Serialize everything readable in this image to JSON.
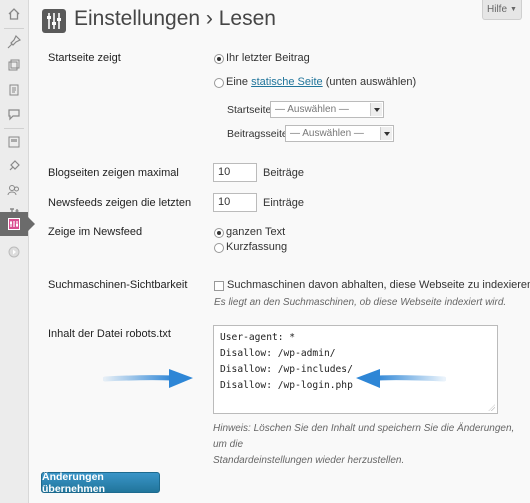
{
  "header": {
    "title": "Einstellungen › Lesen",
    "help_label": "Hilfe"
  },
  "sidebar": {
    "icons": [
      "home-icon",
      "pin-icon",
      "media-icon",
      "pages-icon",
      "comments-icon",
      "appearance-icon",
      "plugins-icon",
      "users-icon",
      "tools-icon",
      "settings-icon",
      "collapse-icon"
    ]
  },
  "front_page": {
    "label": "Startseite zeigt",
    "option_latest": "Ihr letzter Beitrag",
    "option_static_prefix": "Eine",
    "option_static_link": "statische Seite",
    "option_static_suffix": "(unten auswählen)",
    "startseite_label": "Startseite:",
    "startseite_value": "— Auswählen —",
    "beitragsseite_label": "Beitragsseite:",
    "beitragsseite_value": "— Auswählen —"
  },
  "blog_pages": {
    "label": "Blogseiten zeigen maximal",
    "value": "10",
    "unit": "Beiträge"
  },
  "feeds": {
    "label": "Newsfeeds zeigen die letzten",
    "value": "10",
    "unit": "Einträge"
  },
  "feed_content": {
    "label": "Zeige im Newsfeed",
    "option_full": "ganzen Text",
    "option_summary": "Kurzfassung"
  },
  "visibility": {
    "label": "Suchmaschinen-Sichtbarkeit",
    "checkbox_label": "Suchmaschinen davon abhalten, diese Webseite zu indexieren.",
    "description": "Es liegt an den Suchmaschinen, ob diese Webseite indexiert wird."
  },
  "robots": {
    "label": "Inhalt der Datei robots.txt",
    "lines": [
      "User-agent: *",
      "Disallow: /wp-admin/",
      "Disallow: /wp-includes/",
      "Disallow: /wp-login.php"
    ],
    "note_line1": "Hinweis: Löschen Sie den Inhalt und speichern Sie die Änderungen, um die",
    "note_line2": "Standardeinstellungen wieder herzustellen."
  },
  "save_label": "Änderungen übernehmen",
  "colors": {
    "accent": "#21759b",
    "arrow": "#2e86d6"
  }
}
